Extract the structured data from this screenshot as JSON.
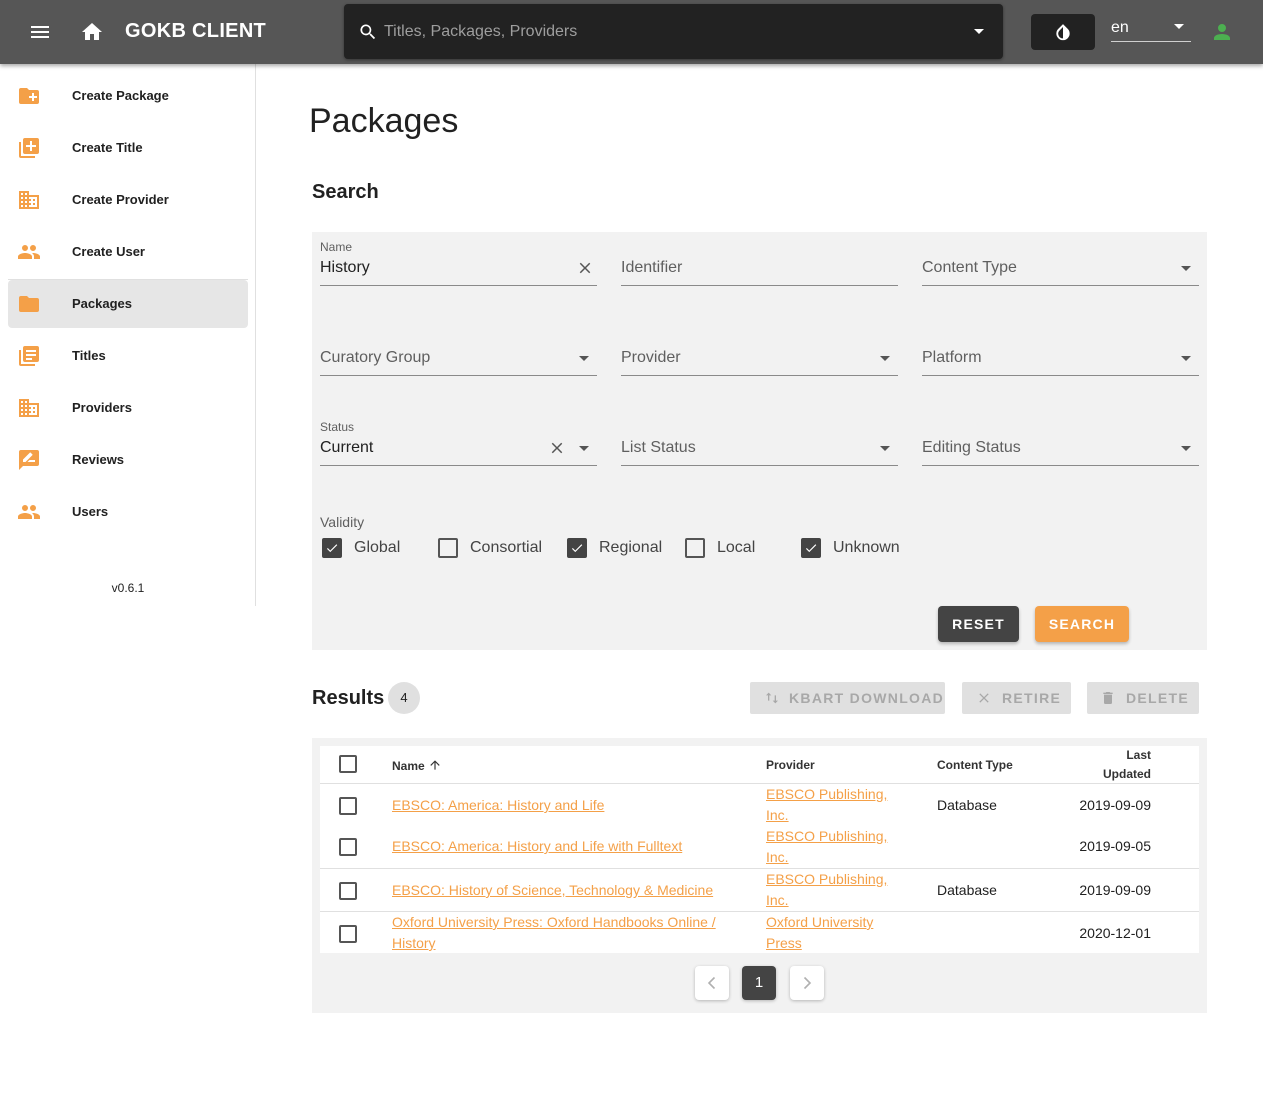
{
  "app": {
    "title": "GOKB CLIENT",
    "search_placeholder": "Titles, Packages, Providers",
    "language": "en",
    "accent_color": "#f4a048",
    "user_icon_color": "#4caf50"
  },
  "sidebar": {
    "items": [
      {
        "label": "Create Package",
        "icon": "folder-plus-icon"
      },
      {
        "label": "Create Title",
        "icon": "library-plus-icon"
      },
      {
        "label": "Create Provider",
        "icon": "domain-icon"
      },
      {
        "label": "Create User",
        "icon": "account-multiple-icon"
      },
      {
        "label": "Packages",
        "icon": "folder-icon",
        "active": true
      },
      {
        "label": "Titles",
        "icon": "library-books-icon"
      },
      {
        "label": "Providers",
        "icon": "domain-icon"
      },
      {
        "label": "Reviews",
        "icon": "rate-review-icon"
      },
      {
        "label": "Users",
        "icon": "account-multiple-icon"
      }
    ],
    "version": "v0.6.1"
  },
  "main": {
    "title": "Packages",
    "search": {
      "heading": "Search",
      "name": {
        "label": "Name",
        "value": "History"
      },
      "identifier": {
        "placeholder": "Identifier"
      },
      "content_type": {
        "placeholder": "Content Type"
      },
      "curatory_group": {
        "placeholder": "Curatory Group"
      },
      "provider": {
        "placeholder": "Provider"
      },
      "platform": {
        "placeholder": "Platform"
      },
      "status": {
        "label": "Status",
        "value": "Current"
      },
      "list_status": {
        "placeholder": "List Status"
      },
      "editing_status": {
        "placeholder": "Editing Status"
      },
      "validity": {
        "label": "Validity",
        "options": [
          {
            "label": "Global",
            "checked": true
          },
          {
            "label": "Consortial",
            "checked": false
          },
          {
            "label": "Regional",
            "checked": true
          },
          {
            "label": "Local",
            "checked": false
          },
          {
            "label": "Unknown",
            "checked": true
          }
        ]
      },
      "reset_label": "RESET",
      "search_label": "SEARCH"
    },
    "results": {
      "heading": "Results",
      "count": "4",
      "kbart_label": "KBART DOWNLOAD",
      "retire_label": "RETIRE",
      "delete_label": "DELETE",
      "columns": {
        "name": "Name",
        "provider": "Provider",
        "content_type": "Content Type",
        "last_updated_1": "Last",
        "last_updated_2": "Updated"
      },
      "rows": [
        {
          "name": "EBSCO: America: History and Life",
          "provider_1": "EBSCO Publishing,",
          "provider_2": "Inc.",
          "content_type": "Database",
          "updated": "2019-09-09"
        },
        {
          "name": "EBSCO: America: History and Life with Fulltext",
          "provider_1": "EBSCO Publishing,",
          "provider_2": "Inc.",
          "content_type": "",
          "updated": "2019-09-05"
        },
        {
          "name": "EBSCO: History of Science, Technology & Medicine",
          "provider_1": "EBSCO Publishing,",
          "provider_2": "Inc.",
          "content_type": "Database",
          "updated": "2019-09-09"
        },
        {
          "name_1": "Oxford University Press: Oxford Handbooks Online /",
          "name_2": "History",
          "provider_1": "Oxford University",
          "provider_2": "Press",
          "content_type": "",
          "updated": "2020-12-01"
        }
      ],
      "pagination": {
        "current_page": "1"
      }
    }
  }
}
